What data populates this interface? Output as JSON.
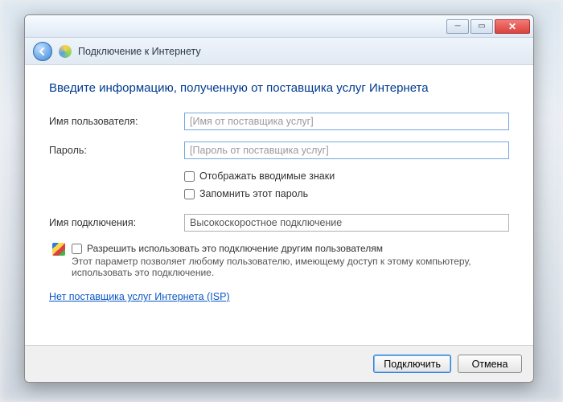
{
  "window": {
    "title": "Подключение к Интернету"
  },
  "heading": "Введите информацию, полученную от поставщика услуг Интернета",
  "fields": {
    "username_label": "Имя пользователя:",
    "username_placeholder": "[Имя от поставщика услуг]",
    "username_value": "",
    "password_label": "Пароль:",
    "password_placeholder": "[Пароль от поставщика услуг]",
    "password_value": "",
    "show_chars_label": "Отображать вводимые знаки",
    "remember_label": "Запомнить этот пароль",
    "conn_name_label": "Имя подключения:",
    "conn_name_value": "Высокоскоростное подключение"
  },
  "share": {
    "checkbox_label": "Разрешить использовать это подключение другим пользователям",
    "description": "Этот параметр позволяет любому пользователю, имеющему доступ к этому компьютеру, использовать это подключение."
  },
  "link": {
    "no_isp": "Нет поставщика услуг Интернета (ISP)"
  },
  "buttons": {
    "connect": "Подключить",
    "cancel": "Отмена"
  }
}
